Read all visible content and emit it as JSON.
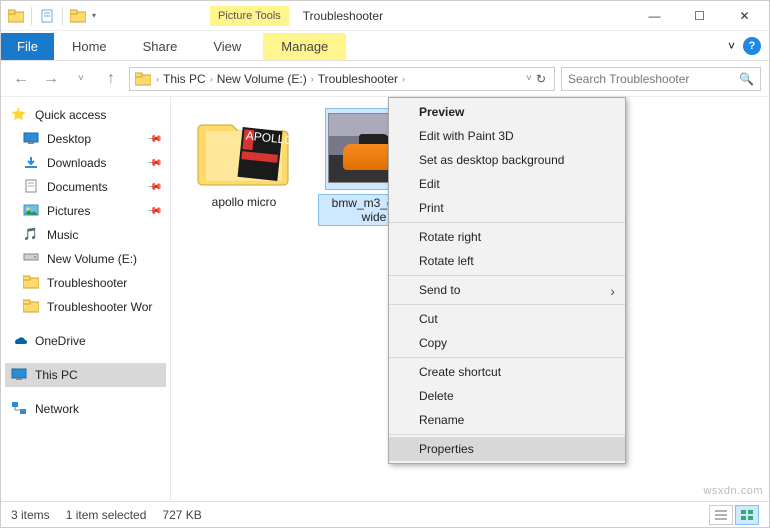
{
  "titlebar": {
    "picture_tools": "Picture Tools",
    "window_title": "Troubleshooter",
    "minimize": "—",
    "maximize": "☐",
    "close": "✕"
  },
  "ribbon": {
    "file": "File",
    "home": "Home",
    "share": "Share",
    "view": "View",
    "manage": "Manage",
    "expand": "˅",
    "help": "?"
  },
  "address": {
    "back": "←",
    "forward": "→",
    "recent": "˅",
    "up": "↑",
    "crumbs": [
      "This PC",
      "New Volume (E:)",
      "Troubleshooter"
    ],
    "dropdown": "˅",
    "refresh": "↻",
    "search_placeholder": "Search Troubleshooter",
    "search_icon": "🔍"
  },
  "nav": {
    "quick_access": "Quick access",
    "desktop": "Desktop",
    "downloads": "Downloads",
    "documents": "Documents",
    "pictures": "Pictures",
    "music": "Music",
    "new_volume": "New Volume (E:)",
    "troubleshooter": "Troubleshooter",
    "troubleshooter_wor": "Troubleshooter Wor",
    "onedrive": "OneDrive",
    "this_pc": "This PC",
    "network": "Network"
  },
  "items": {
    "folder_name": "apollo micro",
    "image_name": "bmw_m3_gts_3\nwide"
  },
  "context": {
    "preview": "Preview",
    "edit_paint3d": "Edit with Paint 3D",
    "set_desktop_bg": "Set as desktop background",
    "edit": "Edit",
    "print": "Print",
    "rotate_right": "Rotate right",
    "rotate_left": "Rotate left",
    "send_to": "Send to",
    "cut": "Cut",
    "copy": "Copy",
    "create_shortcut": "Create shortcut",
    "delete": "Delete",
    "rename": "Rename",
    "properties": "Properties"
  },
  "status": {
    "count": "3 items",
    "selected": "1 item selected",
    "size": "727 KB"
  },
  "watermark": "wsxdn.com"
}
